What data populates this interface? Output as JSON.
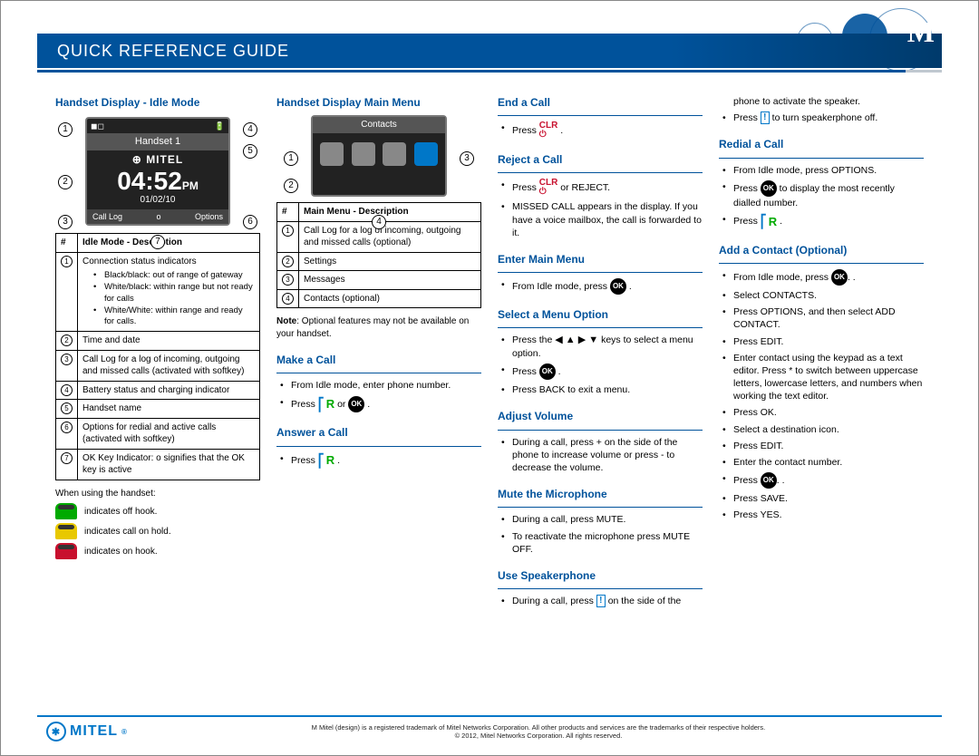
{
  "header": {
    "title": "QUICK REFERENCE GUIDE",
    "logo_letter": "M"
  },
  "col1": {
    "title": "Handset Display - Idle Mode",
    "screen": {
      "handset": "Handset 1",
      "brand": "MITEL",
      "time": "04:52",
      "ampm": "PM",
      "date": "01/02/10",
      "left": "Call Log",
      "mid": "o",
      "right": "Options"
    },
    "table_header_num": "#",
    "table_header_desc": "Idle Mode - Description",
    "rows": [
      {
        "n": "1",
        "t": "Connection status indicators",
        "sub": [
          "Black/black: out of range of gateway",
          "White/black: within range but not ready for calls",
          "White/White: within range and ready for calls."
        ]
      },
      {
        "n": "2",
        "t": "Time and date"
      },
      {
        "n": "3",
        "t": "Call Log for a log of incoming, outgoing and missed calls (activated with softkey)"
      },
      {
        "n": "4",
        "t": "Battery status and charging indicator"
      },
      {
        "n": "5",
        "t": "Handset name"
      },
      {
        "n": "6",
        "t": "Options for redial and active calls (activated with softkey)"
      },
      {
        "n": "7",
        "t": "OK Key Indicator: o signifies that the OK key is active"
      }
    ],
    "when_using": "When using the handset:",
    "hooks": [
      {
        "color": "green",
        "t": "indicates off hook."
      },
      {
        "color": "yellow",
        "t": "indicates call on hold."
      },
      {
        "color": "red",
        "t": "indicates on hook."
      }
    ]
  },
  "col2": {
    "title": "Handset Display Main Menu",
    "menu_title": "Contacts",
    "table_header_num": "#",
    "table_header_desc": "Main Menu - Description",
    "rows": [
      {
        "n": "1",
        "t": "Call Log for a log of incoming, outgoing and missed calls (optional)"
      },
      {
        "n": "2",
        "t": "Settings"
      },
      {
        "n": "3",
        "t": "Messages"
      },
      {
        "n": "4",
        "t": "Contacts (optional)"
      }
    ],
    "note_b": "Note",
    "note": ": Optional features may not be available on your handset.",
    "make_title": "Make a Call",
    "make_1": "From Idle mode, enter phone number.",
    "make_2a": "Press ",
    "make_2b": " or ",
    "answer_title": "Answer a Call",
    "answer_1": "Press "
  },
  "col3": {
    "end_title": "End a Call",
    "end_1": "Press ",
    "reject_title": "Reject a Call",
    "reject_1a": "Press ",
    "reject_1b": " or REJECT.",
    "reject_2": "MISSED CALL appears in the display. If you have a voice mailbox, the call is forwarded to it.",
    "enter_title": "Enter Main Menu",
    "enter_1": "From Idle mode, press ",
    "select_title": "Select a Menu Option",
    "select_1a": "Press the ",
    "select_1b": " keys to select a menu option.",
    "select_2": "Press ",
    "select_3": "Press BACK to exit a menu.",
    "adjust_title": "Adjust Volume",
    "adjust_1": "During a call, press + on the side of the phone to increase volume or press - to decrease the volume.",
    "mute_title": "Mute the Microphone",
    "mute_1": "During a call, press MUTE.",
    "mute_2": "To reactivate the microphone press MUTE OFF.",
    "speaker_title": "Use Speakerphone",
    "speaker_1a": "During a call, press ",
    "speaker_1b": " on the side of the"
  },
  "col4": {
    "cont_1": "phone to activate the speaker.",
    "cont_2a": "Press ",
    "cont_2b": " to turn speakerphone off.",
    "redial_title": "Redial a Call",
    "redial_1": "From Idle mode, press OPTIONS.",
    "redial_2a": "Press ",
    "redial_2b": " to display the most recently dialled number.",
    "redial_3": "Press ",
    "add_title": "Add a Contact (Optional)",
    "add": [
      "From Idle mode, press |OK|.",
      "Select CONTACTS.",
      "Press OPTIONS, and then select ADD CONTACT.",
      "Press EDIT.",
      "Enter contact using the keypad as a text editor. Press * to switch between uppercase letters, lowercase letters, and numbers when working the text editor.",
      "Press OK.",
      "Select a destination icon.",
      "Press EDIT.",
      "Enter the contact number.",
      "Press |OK|.",
      "Press SAVE.",
      "Press YES."
    ]
  },
  "footer": {
    "brand": "MITEL",
    "line1": "M Mitel (design) is a registered trademark of Mitel Networks Corporation. All other products and services are the trademarks of their respective holders.",
    "line2": "© 2012, Mitel Networks Corporation. All rights reserved."
  }
}
